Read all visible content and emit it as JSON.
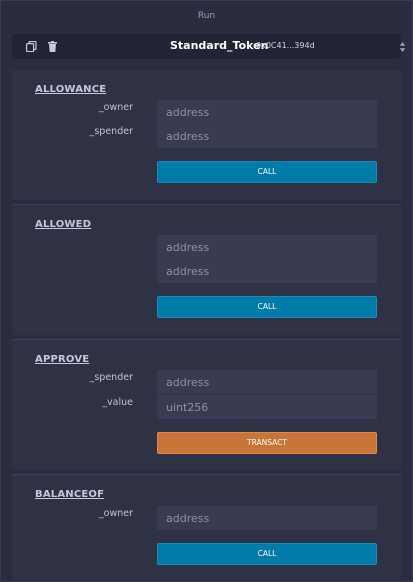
{
  "panel": {
    "title": "Run"
  },
  "contract": {
    "name": "Standard_Token",
    "address": "0x0C41...394d",
    "icons": {
      "copy": "copy-icon",
      "delete": "trash-icon",
      "toggle": "sort-arrows-icon"
    }
  },
  "functions": [
    {
      "name": "ALLOWANCE",
      "params": [
        {
          "label": "_owner",
          "placeholder": "address"
        },
        {
          "label": "_spender",
          "placeholder": "address"
        }
      ],
      "button": "CALL"
    },
    {
      "name": "ALLOWED",
      "params": [
        {
          "label": "",
          "placeholder": "address"
        },
        {
          "label": "",
          "placeholder": "address"
        }
      ],
      "button": "CALL"
    },
    {
      "name": "APPROVE",
      "params": [
        {
          "label": "_spender",
          "placeholder": "address"
        },
        {
          "label": "_value",
          "placeholder": "uint256"
        }
      ],
      "button": "TRANSACT"
    },
    {
      "name": "BALANCEOF",
      "params": [
        {
          "label": "_owner",
          "placeholder": "address"
        }
      ],
      "button": "CALL"
    }
  ],
  "colors": {
    "call": "#007aa6",
    "transact": "#c97539",
    "background": "#2a2c3f",
    "input": "#393b50"
  }
}
